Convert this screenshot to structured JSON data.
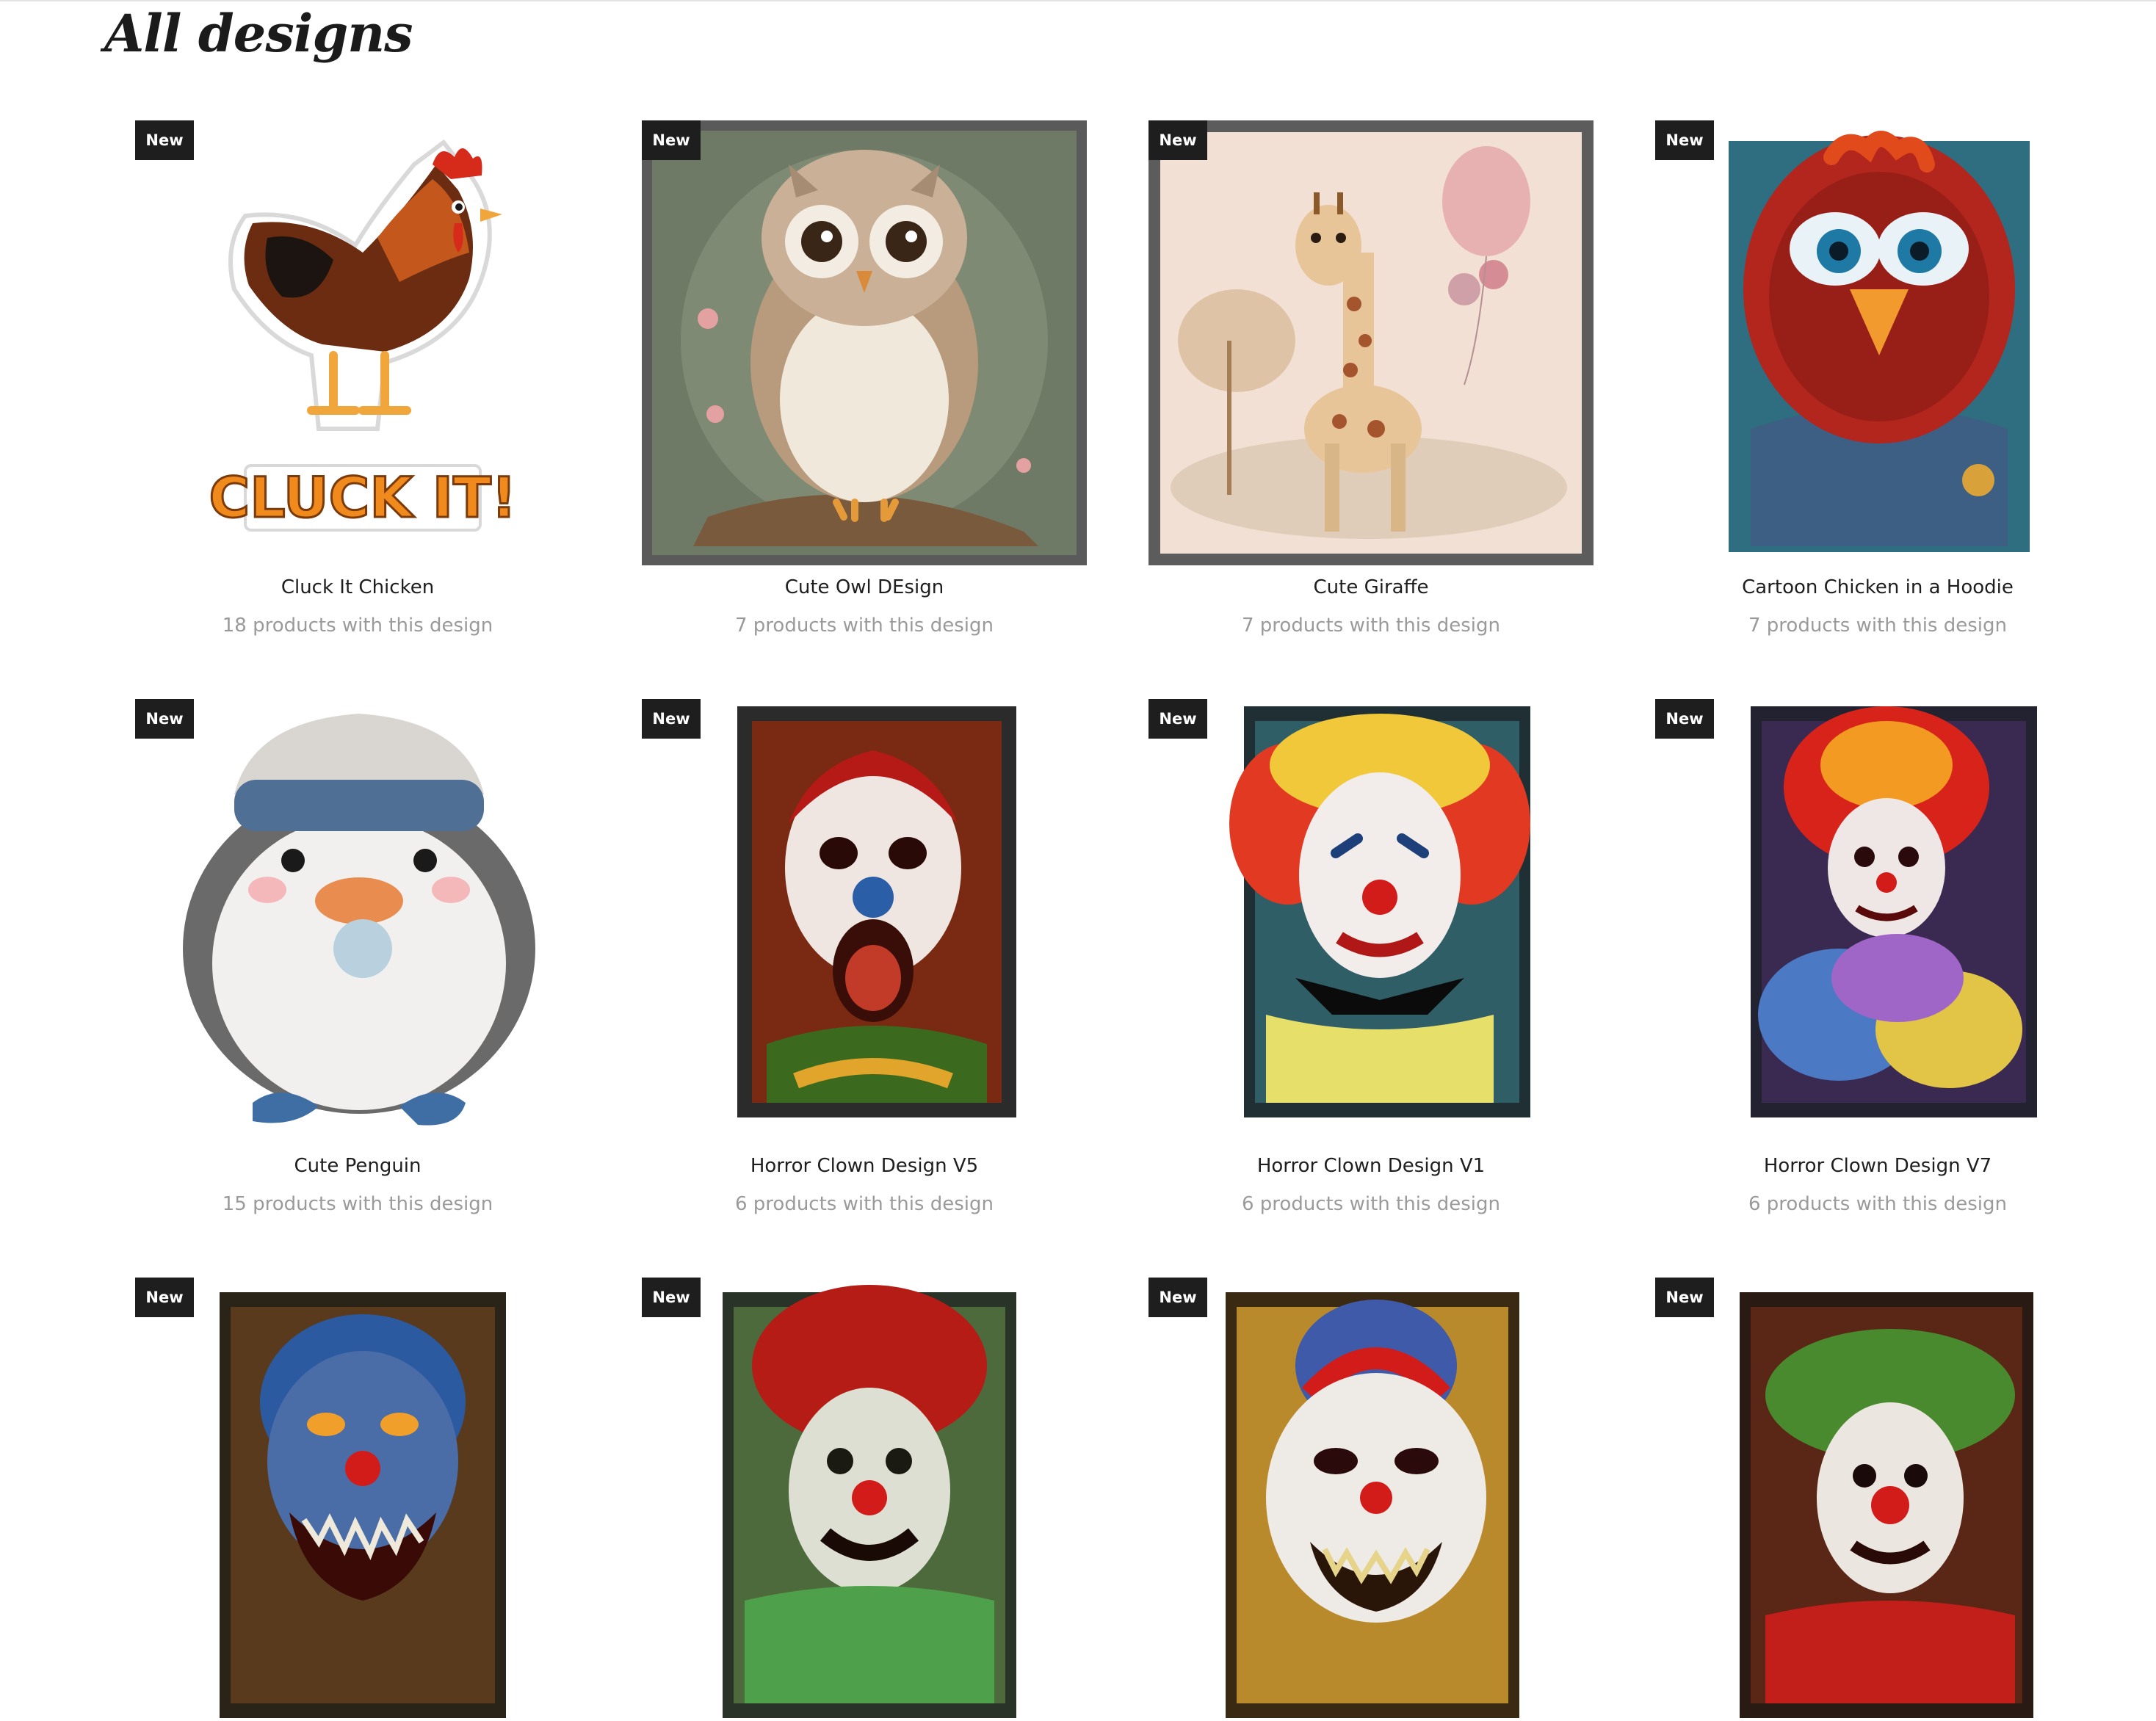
{
  "page": {
    "title": "All designs"
  },
  "badge_label": "New",
  "designs": [
    {
      "title": "Cluck It Chicken",
      "count": "18 products with this design",
      "badge": "New",
      "image_subject": "rooster-sticker",
      "sticker_text": "CLUCK IT!"
    },
    {
      "title": "Cute Owl DEsign",
      "count": "7 products with this design",
      "badge": "New",
      "image_subject": "owl"
    },
    {
      "title": "Cute Giraffe",
      "count": "7 products with this design",
      "badge": "New",
      "image_subject": "giraffe"
    },
    {
      "title": "Cartoon Chicken in a Hoodie",
      "count": "7 products with this design",
      "badge": "New",
      "image_subject": "cartoon-chicken"
    },
    {
      "title": "Cute Penguin",
      "count": "15 products with this design",
      "badge": "New",
      "image_subject": "penguin"
    },
    {
      "title": "Horror Clown Design V5",
      "count": "6 products with this design",
      "badge": "New",
      "image_subject": "horror-clown"
    },
    {
      "title": "Horror Clown Design V1",
      "count": "6 products with this design",
      "badge": "New",
      "image_subject": "horror-clown"
    },
    {
      "title": "Horror Clown Design V7",
      "count": "6 products with this design",
      "badge": "New",
      "image_subject": "horror-clown"
    },
    {
      "title": "",
      "count": "",
      "badge": "New",
      "image_subject": "horror-clown"
    },
    {
      "title": "",
      "count": "",
      "badge": "New",
      "image_subject": "horror-clown"
    },
    {
      "title": "",
      "count": "",
      "badge": "New",
      "image_subject": "horror-clown"
    },
    {
      "title": "",
      "count": "",
      "badge": "New",
      "image_subject": "horror-clown"
    }
  ]
}
